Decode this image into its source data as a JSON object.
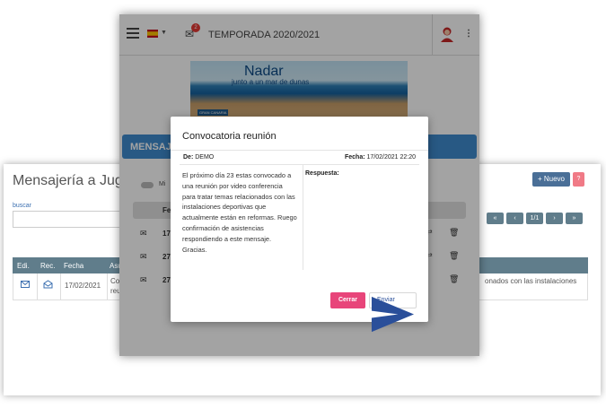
{
  "back": {
    "title": "Mensajería a Jugado",
    "new_label": "+ Nuevo",
    "help_label": "?",
    "search_label": "buscar",
    "columns": [
      "Edi.",
      "Rec.",
      "Fecha",
      "Asu"
    ],
    "row": {
      "fecha": "17/02/2021",
      "asunto_l1": "Con",
      "asunto_l2": "reun",
      "right_text": "onados con las instalaciones"
    },
    "pager": {
      "first": "«",
      "prev": "‹",
      "page": "1/1",
      "next": "›",
      "last": "»"
    }
  },
  "app": {
    "season": "TEMPORADA 2020/2021",
    "mail_badge": "2",
    "banner": {
      "line1": "Nadar",
      "line2": "junto a un mar de dunas",
      "logo": "GRAN CANARIA"
    },
    "section_title": "MENSAJE",
    "toggle_label": "Mi",
    "list_head": "Fe",
    "rows": [
      {
        "date": "17"
      },
      {
        "date": "27"
      },
      {
        "date": "27"
      }
    ]
  },
  "modal": {
    "title": "Convocatoria reunión",
    "from_label": "De:",
    "from_value": "DEMO",
    "date_label": "Fecha:",
    "date_value": "17/02/2021 22:20",
    "body": "El próximo día 23 estas convocado a una reunión por video conferencia para tratar temas relacionados con las instalaciones deportivas que actualmente están en reformas. Ruego confirmación de asistencias respondiendo a este mensaje. Gracias.",
    "response_label": "Respuesta:",
    "close_label": "Cerrar",
    "send_label": "Enviar"
  },
  "colors": {
    "accent": "#3f8ccf",
    "close": "#e8457a",
    "table_header": "#607d8b"
  }
}
